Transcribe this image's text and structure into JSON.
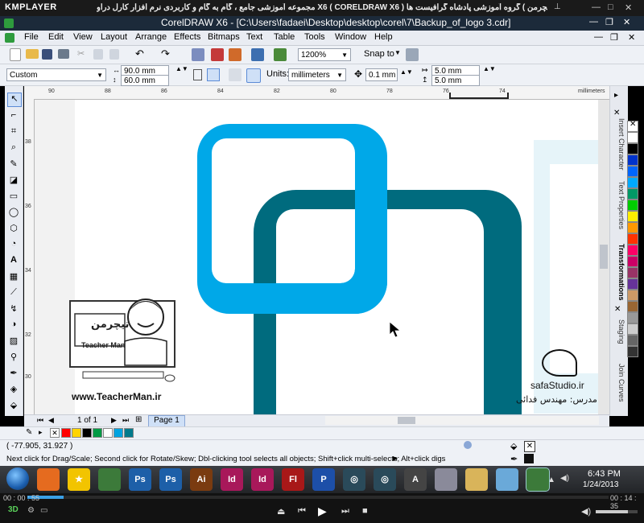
{
  "kmplayer": {
    "logo": "KMPLAYER",
    "video_title": "مجموعه آموزشی جامع ، گام به گام و کاربردی نرم افزار کارل دراو X6 ( CORELDRAW X6 )   مدرس : سعید فدایی ( تیچرمن ) گروه آموزشی پادشاه گرافیست ها",
    "time_elapsed": "00 : 00 : 55",
    "time_total": "00 : 14 : 35",
    "badge_3d": "3D"
  },
  "window": {
    "title": "CorelDRAW X6 - [C:\\Users\\fadaei\\Desktop\\desktop\\corel\\7\\Backup_of_logo 3.cdr]"
  },
  "menu": [
    "File",
    "Edit",
    "View",
    "Layout",
    "Arrange",
    "Effects",
    "Bitmaps",
    "Text",
    "Table",
    "Tools",
    "Window",
    "Help"
  ],
  "toolbar": {
    "zoom": "1200%",
    "snap_to": "Snap to"
  },
  "propertybar": {
    "page_preset": "Custom",
    "width": "90.0 mm",
    "height": "60.0 mm",
    "units_label": "Units:",
    "units": "millimeters",
    "nudge": "0.1 mm",
    "dup_x": "5.0 mm",
    "dup_y": "5.0 mm"
  },
  "ruler": {
    "h_ticks": [
      "90",
      "88",
      "86",
      "84",
      "82",
      "80",
      "78",
      "76",
      "74"
    ],
    "h_unit": "millimeters",
    "v_ticks": [
      "38",
      "36",
      "34",
      "32",
      "30"
    ],
    "v_unit": "millimeters"
  },
  "dockers": [
    "Insert Character",
    "Text Properties",
    "Transformations",
    "Staging",
    "Join Curves"
  ],
  "pagebar": {
    "page_count": "1 of 1",
    "page_tab": "Page 1"
  },
  "watermark": {
    "site": "www.TeacherMan.ir",
    "logo_text": "Teacher Man",
    "logo_fa": "تیچرمن",
    "studio": "safaStudio.ir",
    "instructor": "مدرس: مهندس فدائی"
  },
  "status": {
    "coords": "( -77.905, 31.927 )",
    "hint": "Next click for Drag/Scale; Second click for Rotate/Skew; Dbl-clicking tool selects all objects; Shift+click multi-selects; Alt+click digs"
  },
  "taskbar": {
    "time": "6:43 PM",
    "date": "1/24/2013",
    "apps": [
      {
        "name": "firefox",
        "label": ""
      },
      {
        "name": "favorites",
        "label": "★"
      },
      {
        "name": "corel-tray",
        "label": ""
      },
      {
        "name": "photoshop-1",
        "label": "Ps"
      },
      {
        "name": "photoshop-2",
        "label": "Ps"
      },
      {
        "name": "illustrator",
        "label": "Ai"
      },
      {
        "name": "indesign-1",
        "label": "Id"
      },
      {
        "name": "indesign-2",
        "label": "Id"
      },
      {
        "name": "flash",
        "label": "Fl"
      },
      {
        "name": "corel-capture",
        "label": "P"
      },
      {
        "name": "app-gear-1",
        "label": "◎"
      },
      {
        "name": "app-gear-2",
        "label": "◎"
      },
      {
        "name": "app-sign",
        "label": "A"
      },
      {
        "name": "disc",
        "label": ""
      },
      {
        "name": "explorer",
        "label": ""
      },
      {
        "name": "blank-app",
        "label": ""
      },
      {
        "name": "corel-active",
        "label": ""
      }
    ]
  },
  "colors": {
    "light_blue": "#00a8e8",
    "teal": "#006b7e",
    "doc_palette": [
      "#ff0000",
      "#ffd400",
      "#000000",
      "#009a44",
      "#ffffff",
      "#00a3e0",
      "#007a8c"
    ],
    "palette": [
      "#ffffff",
      "#000000",
      "#0033cc",
      "#0066ff",
      "#00aaff",
      "#009966",
      "#00cc00",
      "#ffee00",
      "#ff9900",
      "#ff3300",
      "#ff0066",
      "#cc0066",
      "#993366",
      "#663399",
      "#cc9966",
      "#996633",
      "#999999",
      "#cccccc",
      "#666666",
      "#333333"
    ]
  }
}
